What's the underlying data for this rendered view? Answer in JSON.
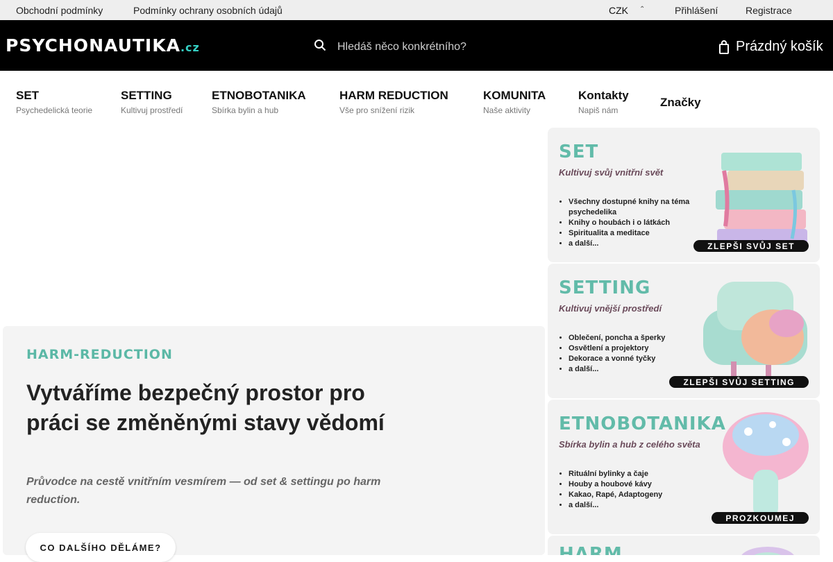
{
  "topbar": {
    "terms": "Obchodní podmínky",
    "privacy": "Podmínky ochrany osobních údajů",
    "currency": "CZK",
    "currency_caret": "⌃",
    "login": "Přihlášení",
    "register": "Registrace"
  },
  "header": {
    "logo_main": "PSYCHONAUTIKA",
    "logo_tld": ".cz",
    "search_placeholder": "Hledáš něco konkrétního?",
    "cart_label": "Prázdný košík"
  },
  "nav": {
    "items": [
      {
        "title": "SET",
        "subtitle": "Psychedelická teorie"
      },
      {
        "title": "SETTING",
        "subtitle": "Kultivuj prostředí"
      },
      {
        "title": "ETNOBOTANIKA",
        "subtitle": "Sbírka bylin a hub"
      },
      {
        "title": "HARM REDUCTION",
        "subtitle": "Vše pro snížení rizik"
      },
      {
        "title": "KOMUNITA",
        "subtitle": "Naše aktivity"
      },
      {
        "title": "Kontakty",
        "subtitle": "Napiš nám"
      },
      {
        "title": "Značky",
        "subtitle": ""
      }
    ]
  },
  "hero": {
    "eyebrow": "HARM-REDUCTION",
    "title": "Vytváříme bezpečný prostor pro práci se změněnými stavy vědomí",
    "subtitle": "Průvodce na cestě vnitřním vesmírem — od set & settingu po harm reduction.",
    "button": "CO DALŠÍHO DĚLÁME?"
  },
  "cards": [
    {
      "title": "SET",
      "subtitle": "Kultivuj svůj vnitřní svět",
      "bullets": [
        "Všechny dostupné knihy na téma psychedelika",
        "Knihy o houbách i o látkách",
        "Spiritualita a meditace",
        "a další..."
      ],
      "button": "ZLEPŠI SVŮJ SET",
      "art": "books-icon"
    },
    {
      "title": "SETTING",
      "subtitle": "Kultivuj vnější prostředí",
      "bullets": [
        "Oblečení, poncha a šperky",
        "Osvětlení a projektory",
        "Dekorace a vonné tyčky",
        "a další..."
      ],
      "button": "ZLEPŠI SVŮJ SETTING",
      "art": "armchair-icon"
    },
    {
      "title": "ETNOBOTANIKA",
      "subtitle": "Sbírka bylin a hub z celého světa",
      "bullets": [
        "Rituální bylinky a čaje",
        "Houby a houbové kávy",
        "Kakao, Rapé, Adaptogeny",
        "a další..."
      ],
      "button": "PROZKOUMEJ",
      "art": "mushroom-icon"
    },
    {
      "title": "HARM",
      "subtitle": "",
      "bullets": [],
      "button": "",
      "art": "pill-icon"
    }
  ],
  "colors": {
    "accent_teal": "#62bba9",
    "header_bg": "#000000",
    "topbar_bg": "#eeeeee",
    "card_bg": "#f2f2f2"
  }
}
